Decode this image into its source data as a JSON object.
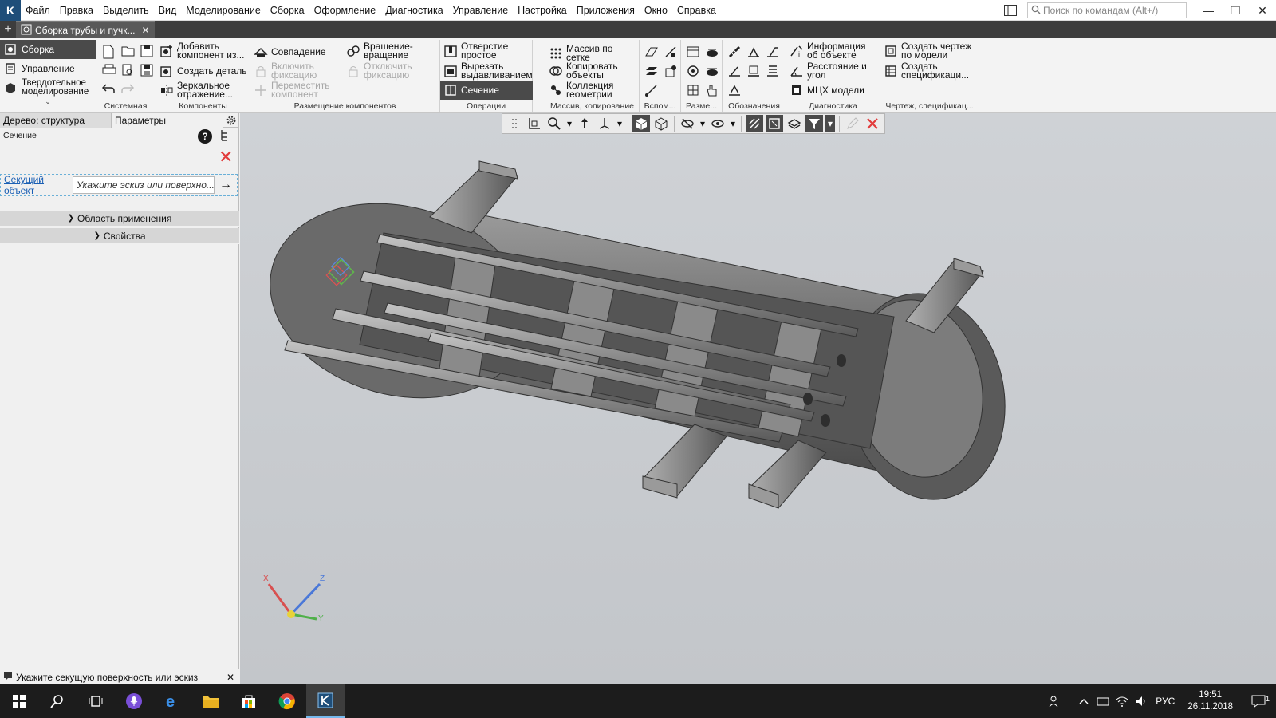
{
  "menubar": {
    "items": [
      "Файл",
      "Правка",
      "Выделить",
      "Вид",
      "Моделирование",
      "Сборка",
      "Оформление",
      "Диагностика",
      "Управление",
      "Настройка",
      "Приложения",
      "Окно",
      "Справка"
    ],
    "search_placeholder": "Поиск по командам (Alt+/)"
  },
  "document_tab": {
    "title": "Сборка трубы и пучк..."
  },
  "ribbon": {
    "modes": [
      "Сборка",
      "Управление",
      "Твердотельное моделирование"
    ],
    "groups": {
      "system": "Системная",
      "components": "Компоненты",
      "placement": "Размещение компонентов",
      "operations": "Операции",
      "array": "Массив, копирование",
      "aux": "Вспом...",
      "dims": "Разме...",
      "notation": "Обозначения",
      "diagnostics": "Диагностика",
      "drawing": "Чертеж, спецификац..."
    },
    "buttons": {
      "add_component": "Добавить компонент из...",
      "create_part": "Создать деталь",
      "mirror": "Зеркальное отражение...",
      "coincidence": "Совпадение",
      "rotation": "Вращение-вращение",
      "enable_fix": "Включить фиксацию",
      "disable_fix": "Отключить фиксацию",
      "move_component": "Переместить компонент",
      "hole_simple": "Отверстие простое",
      "cut_extrude": "Вырезать выдавливанием",
      "section": "Сечение",
      "grid_array": "Массив по сетке",
      "copy_objects": "Копировать объекты",
      "geometry_collection": "Коллекция геометрии",
      "object_info": "Информация об объекте",
      "distance_angle": "Расстояние и угол",
      "mass_properties": "МЦХ модели",
      "create_drawing": "Создать чертеж по модели",
      "create_spec": "Создать спецификаци..."
    }
  },
  "left_panel": {
    "tabs": [
      "Дерево: структура",
      "Параметры"
    ],
    "section_title": "Сечение",
    "cut_object_label": "Секущий объект",
    "cut_object_placeholder": "Укажите эскиз или поверхно...",
    "accordion": [
      "Область применения",
      "Свойства"
    ]
  },
  "status": {
    "message": "Укажите секущую поверхность или эскиз"
  },
  "axes": {
    "x": "X",
    "y": "Y",
    "z": "Z"
  },
  "taskbar": {
    "language": "РУС",
    "time": "19:51",
    "date": "26.11.2018",
    "notifications": "1"
  },
  "colors": {
    "accent_dark": "#4a4a4a",
    "close_red": "#e23b3b",
    "link_blue": "#1a5fb4",
    "viewport_bg": "#c9ccd0",
    "model_gray": "#808080"
  }
}
